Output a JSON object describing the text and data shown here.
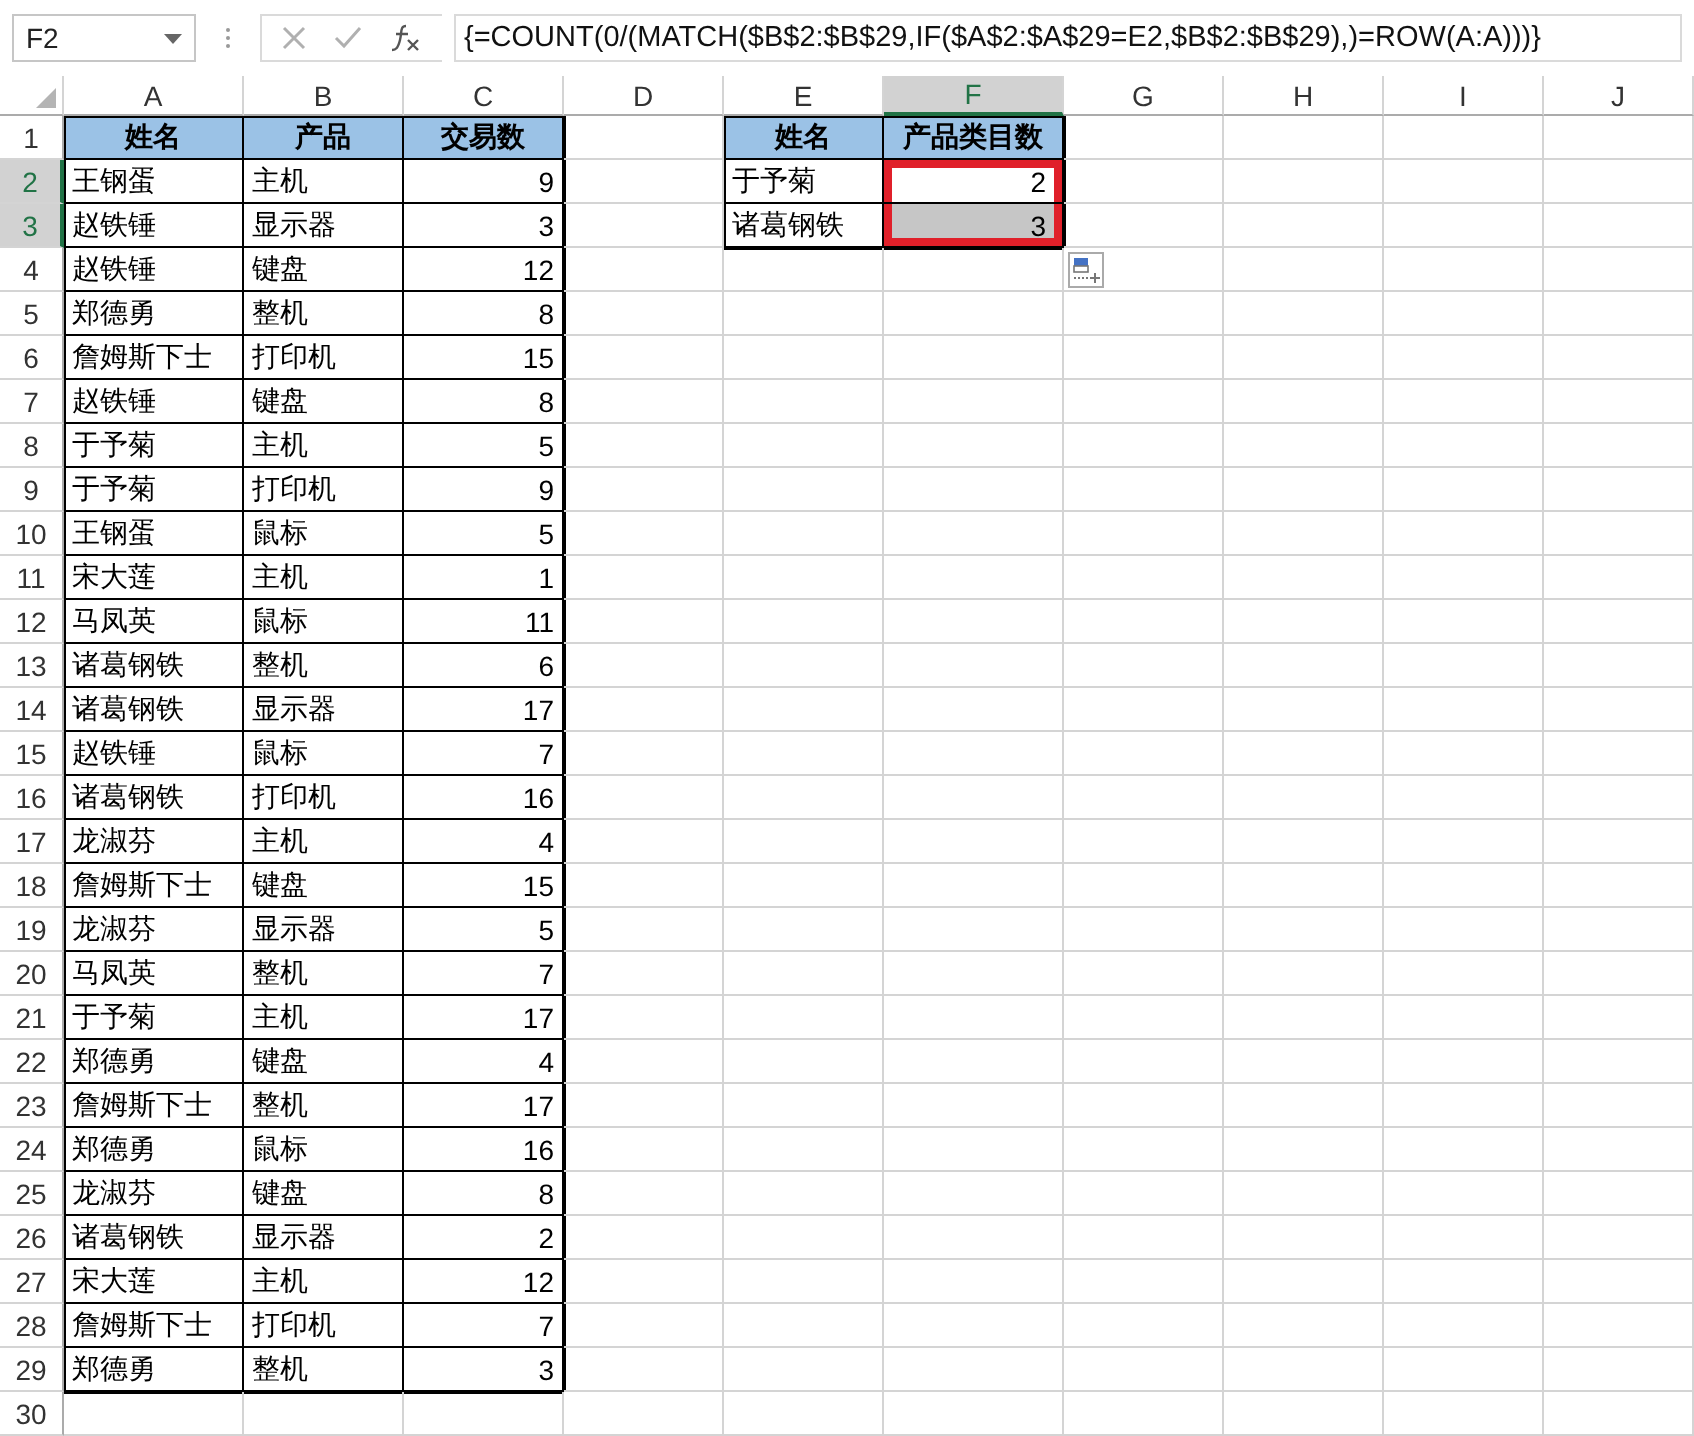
{
  "formula_bar": {
    "name_box": "F2",
    "formula": "{=COUNT(0/(MATCH($B$2:$B$29,IF($A$2:$A$29=E2,$B$2:$B$29),)=ROW(A:A)))}"
  },
  "columns": [
    {
      "letter": "A",
      "selected": false
    },
    {
      "letter": "B",
      "selected": false
    },
    {
      "letter": "C",
      "selected": false
    },
    {
      "letter": "D",
      "selected": false
    },
    {
      "letter": "E",
      "selected": false
    },
    {
      "letter": "F",
      "selected": true
    },
    {
      "letter": "G",
      "selected": false
    },
    {
      "letter": "H",
      "selected": false
    },
    {
      "letter": "I",
      "selected": false
    },
    {
      "letter": "J",
      "selected": false
    }
  ],
  "row_headers": [
    {
      "number": "1",
      "selected": false
    },
    {
      "number": "2",
      "selected": true
    },
    {
      "number": "3",
      "selected": true
    },
    {
      "number": "4",
      "selected": false
    },
    {
      "number": "5",
      "selected": false
    },
    {
      "number": "6",
      "selected": false
    },
    {
      "number": "7",
      "selected": false
    },
    {
      "number": "8",
      "selected": false
    },
    {
      "number": "9",
      "selected": false
    },
    {
      "number": "10",
      "selected": false
    },
    {
      "number": "11",
      "selected": false
    },
    {
      "number": "12",
      "selected": false
    },
    {
      "number": "13",
      "selected": false
    },
    {
      "number": "14",
      "selected": false
    },
    {
      "number": "15",
      "selected": false
    },
    {
      "number": "16",
      "selected": false
    },
    {
      "number": "17",
      "selected": false
    },
    {
      "number": "18",
      "selected": false
    },
    {
      "number": "19",
      "selected": false
    },
    {
      "number": "20",
      "selected": false
    },
    {
      "number": "21",
      "selected": false
    },
    {
      "number": "22",
      "selected": false
    },
    {
      "number": "23",
      "selected": false
    },
    {
      "number": "24",
      "selected": false
    },
    {
      "number": "25",
      "selected": false
    },
    {
      "number": "26",
      "selected": false
    },
    {
      "number": "27",
      "selected": false
    },
    {
      "number": "28",
      "selected": false
    },
    {
      "number": "29",
      "selected": false
    },
    {
      "number": "30",
      "selected": false
    }
  ],
  "data_table": {
    "header": [
      "姓名",
      "产品",
      "交易数"
    ],
    "rows": [
      [
        "王钢蛋",
        "主机",
        "9"
      ],
      [
        "赵铁锤",
        "显示器",
        "3"
      ],
      [
        "赵铁锤",
        "键盘",
        "12"
      ],
      [
        "郑德勇",
        "整机",
        "8"
      ],
      [
        "詹姆斯下士",
        "打印机",
        "15"
      ],
      [
        "赵铁锤",
        "键盘",
        "8"
      ],
      [
        "于予菊",
        "主机",
        "5"
      ],
      [
        "于予菊",
        "打印机",
        "9"
      ],
      [
        "王钢蛋",
        "鼠标",
        "5"
      ],
      [
        "宋大莲",
        "主机",
        "1"
      ],
      [
        "马凤英",
        "鼠标",
        "11"
      ],
      [
        "诸葛钢铁",
        "整机",
        "6"
      ],
      [
        "诸葛钢铁",
        "显示器",
        "17"
      ],
      [
        "赵铁锤",
        "鼠标",
        "7"
      ],
      [
        "诸葛钢铁",
        "打印机",
        "16"
      ],
      [
        "龙淑芬",
        "主机",
        "4"
      ],
      [
        "詹姆斯下士",
        "键盘",
        "15"
      ],
      [
        "龙淑芬",
        "显示器",
        "5"
      ],
      [
        "马凤英",
        "整机",
        "7"
      ],
      [
        "于予菊",
        "主机",
        "17"
      ],
      [
        "郑德勇",
        "键盘",
        "4"
      ],
      [
        "詹姆斯下士",
        "整机",
        "17"
      ],
      [
        "郑德勇",
        "鼠标",
        "16"
      ],
      [
        "龙淑芬",
        "键盘",
        "8"
      ],
      [
        "诸葛钢铁",
        "显示器",
        "2"
      ],
      [
        "宋大莲",
        "主机",
        "12"
      ],
      [
        "詹姆斯下士",
        "打印机",
        "7"
      ],
      [
        "郑德勇",
        "整机",
        "3"
      ]
    ]
  },
  "summary_table": {
    "header": [
      "姓名",
      "产品类目数"
    ],
    "quick_analysis": true,
    "rows": [
      {
        "name": "于予菊",
        "count": "2",
        "selected": true,
        "active": true
      },
      {
        "name": "诸葛钢铁",
        "count": "3",
        "selected": true,
        "active": false
      }
    ]
  }
}
